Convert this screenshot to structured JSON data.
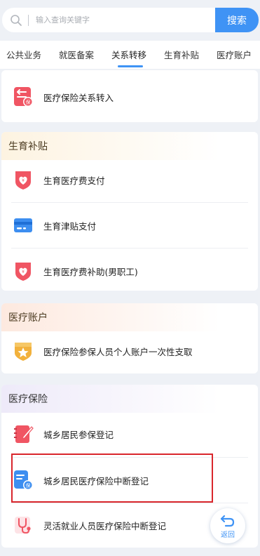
{
  "search": {
    "placeholder": "输入查询关键字",
    "button_label": "搜索"
  },
  "tabs": [
    {
      "label": "公共业务"
    },
    {
      "label": "就医备案"
    },
    {
      "label": "关系转移",
      "active": true
    },
    {
      "label": "生育补贴"
    },
    {
      "label": "医疗账户"
    }
  ],
  "transfer_section": {
    "items": [
      {
        "label": "医疗保险关系转入",
        "icon": "transfer-in-icon"
      }
    ]
  },
  "maternity_section": {
    "title": "生育补贴",
    "items": [
      {
        "label": "生育医疗费支付",
        "icon": "heart-shield-icon"
      },
      {
        "label": "生育津贴支付",
        "icon": "card-icon"
      },
      {
        "label": "生育医疗费补助(男职工)",
        "icon": "heart-shield-icon"
      }
    ]
  },
  "account_section": {
    "title": "医疗账户",
    "items": [
      {
        "label": "医疗保险参保人员个人账户一次性支取",
        "icon": "star-badge-icon"
      }
    ]
  },
  "insurance_section": {
    "title": "医疗保险",
    "items": [
      {
        "label": "城乡居民参保登记",
        "icon": "notebook-pen-icon"
      },
      {
        "label": "城乡居民医疗保险中断登记",
        "icon": "document-insurance-icon"
      },
      {
        "label": "灵活就业人员医疗保险中断登记",
        "icon": "stethoscope-icon"
      }
    ]
  },
  "back_button": {
    "label": "返回"
  },
  "colors": {
    "accent": "#3f93f5",
    "highlight": "#d9262c",
    "icon_red": "#f05563",
    "icon_blue": "#3d8ef0",
    "icon_gold": "#f2b13c"
  }
}
